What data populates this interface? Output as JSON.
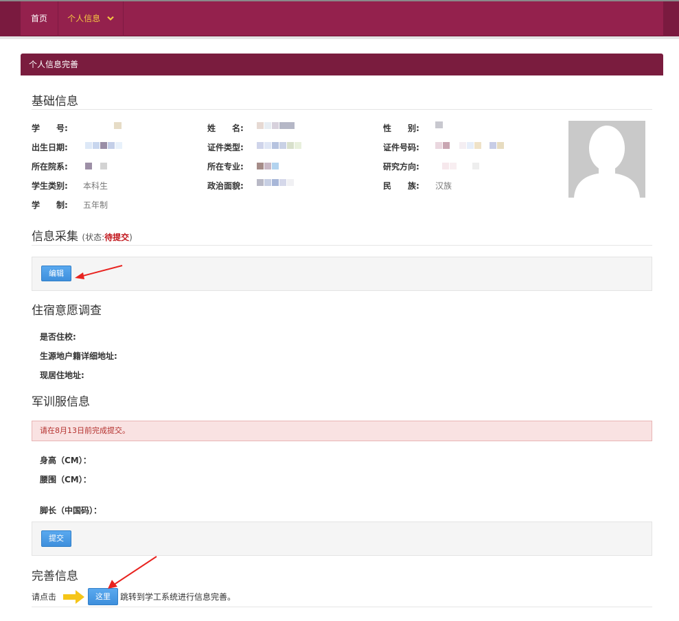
{
  "nav": {
    "home": "首页",
    "profile": "个人信息"
  },
  "panel": {
    "title": "个人信息完善"
  },
  "basic": {
    "title": "基础信息",
    "fields": {
      "student_id_label": "学　　号:",
      "name_label": "姓　　名:",
      "gender_label": "性　　别:",
      "birth_label": "出生日期:",
      "id_type_label": "证件类型:",
      "id_number_label": "证件号码:",
      "dept_label": "所在院系:",
      "major_label": "所在专业:",
      "research_label": "研究方向:",
      "student_type_label": "学生类别:",
      "student_type_value": "本科生",
      "political_label": "政治面貌:",
      "ethnicity_label": "民　　族:",
      "ethnicity_value": "汉族",
      "duration_label": "学　　制:",
      "duration_value": "五年制"
    }
  },
  "collect": {
    "title": "信息采集",
    "status_prefix": "(状态:",
    "status_value": "待提交",
    "status_suffix": ")",
    "edit_button": "编辑"
  },
  "housing": {
    "title": "住宿意愿调查",
    "on_campus_label": "是否住校:",
    "origin_address_label": "生源地户籍详细地址:",
    "current_address_label": "现居住地址:"
  },
  "uniform": {
    "title": "军训服信息",
    "alert": "请在8月13日前完成提交。",
    "height_label": "身高（CM）：",
    "waist_label": "腰围（CM）：",
    "foot_label": "脚长（中国码）：",
    "submit_button": "提交"
  },
  "complete": {
    "title": "完善信息",
    "prefix": "请点击",
    "here_button": "这里",
    "suffix": "跳转到学工系统进行信息完善。"
  },
  "colors": {
    "nav_bg": "#94214d",
    "nav_active": "#f5c542",
    "panel_head": "#7a1c3e",
    "button": "#3e8fdc",
    "status_red": "#c1151b",
    "alert_bg": "#f9e2e2",
    "annotation_arrow": "#e8231f",
    "pointer_arrow": "#f5c518"
  }
}
